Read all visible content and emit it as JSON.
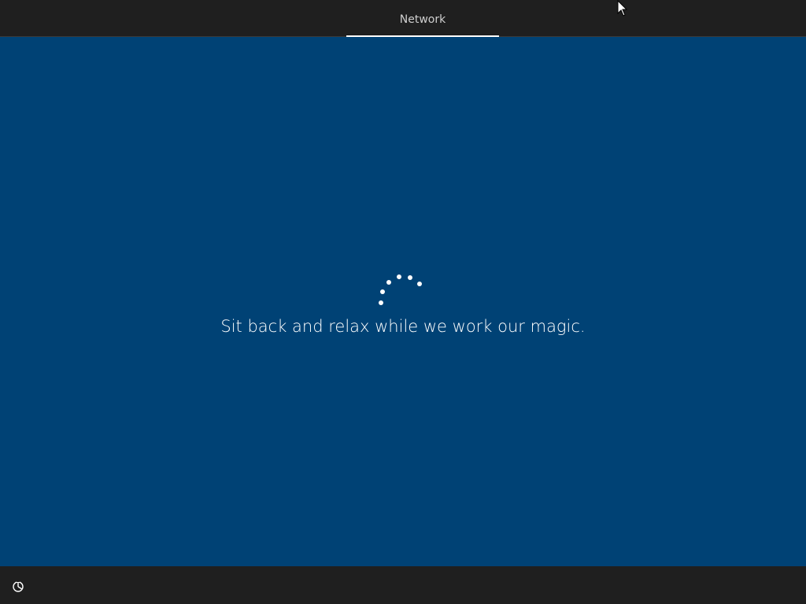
{
  "header": {
    "steps": [
      {
        "label": "Network",
        "active": true
      }
    ]
  },
  "main": {
    "status_message": "Sit back and relax while we work our magic."
  },
  "footer": {
    "ease_of_access_icon": "ease-of-access-icon"
  },
  "colors": {
    "background": "#004275",
    "bar": "#1f1f1f",
    "text": "#ffffff",
    "tab_text": "#cfcfcf"
  }
}
